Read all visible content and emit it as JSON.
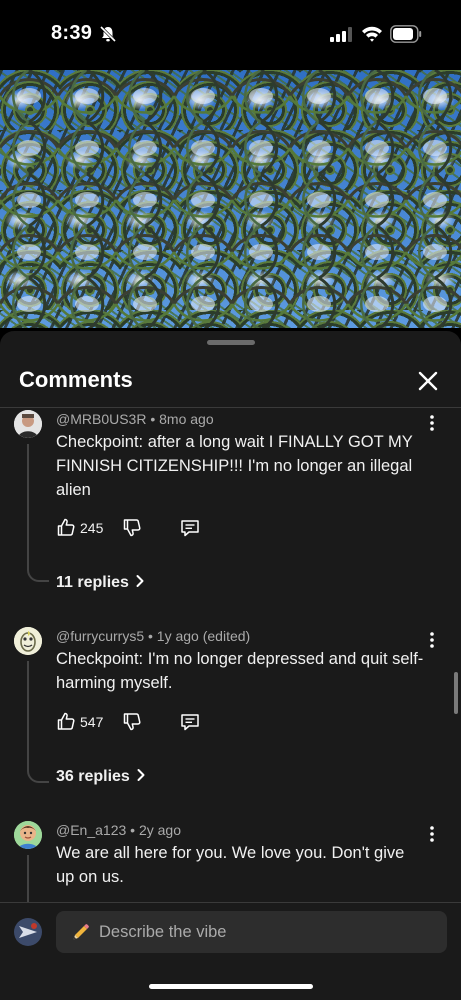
{
  "status_bar": {
    "time": "8:39"
  },
  "sheet": {
    "title": "Comments"
  },
  "comments": [
    {
      "author": "@MRB0US3R",
      "age": "8mo ago",
      "text": "Checkpoint: after a long wait I FINALLY GOT MY FINNISH CITIZENSHIP!!! I'm no longer an illegal alien",
      "likes": "245",
      "replies": "11 replies"
    },
    {
      "author": "@furrycurrys5",
      "age": "1y ago (edited)",
      "text": "Checkpoint: I'm no longer depressed and quit self-harming myself.",
      "likes": "547",
      "replies": "36 replies"
    },
    {
      "author": "@En_a123",
      "age": "2y ago",
      "text": "We are all here for you. We love you. Don't give up on us."
    }
  ],
  "composer": {
    "placeholder": "Describe the vibe"
  },
  "colors": {
    "sheet_bg": "#1a1a1a",
    "text": "#f1f1f1",
    "meta": "#aaaaaa",
    "input_bg": "#2d2d2d"
  },
  "icons": [
    "bell-slash-icon",
    "signal-icon",
    "wifi-icon",
    "battery-icon",
    "close-icon",
    "kebab-icon",
    "like-icon",
    "dislike-icon",
    "reply-icon",
    "chevron-right-icon",
    "pencil-icon"
  ]
}
